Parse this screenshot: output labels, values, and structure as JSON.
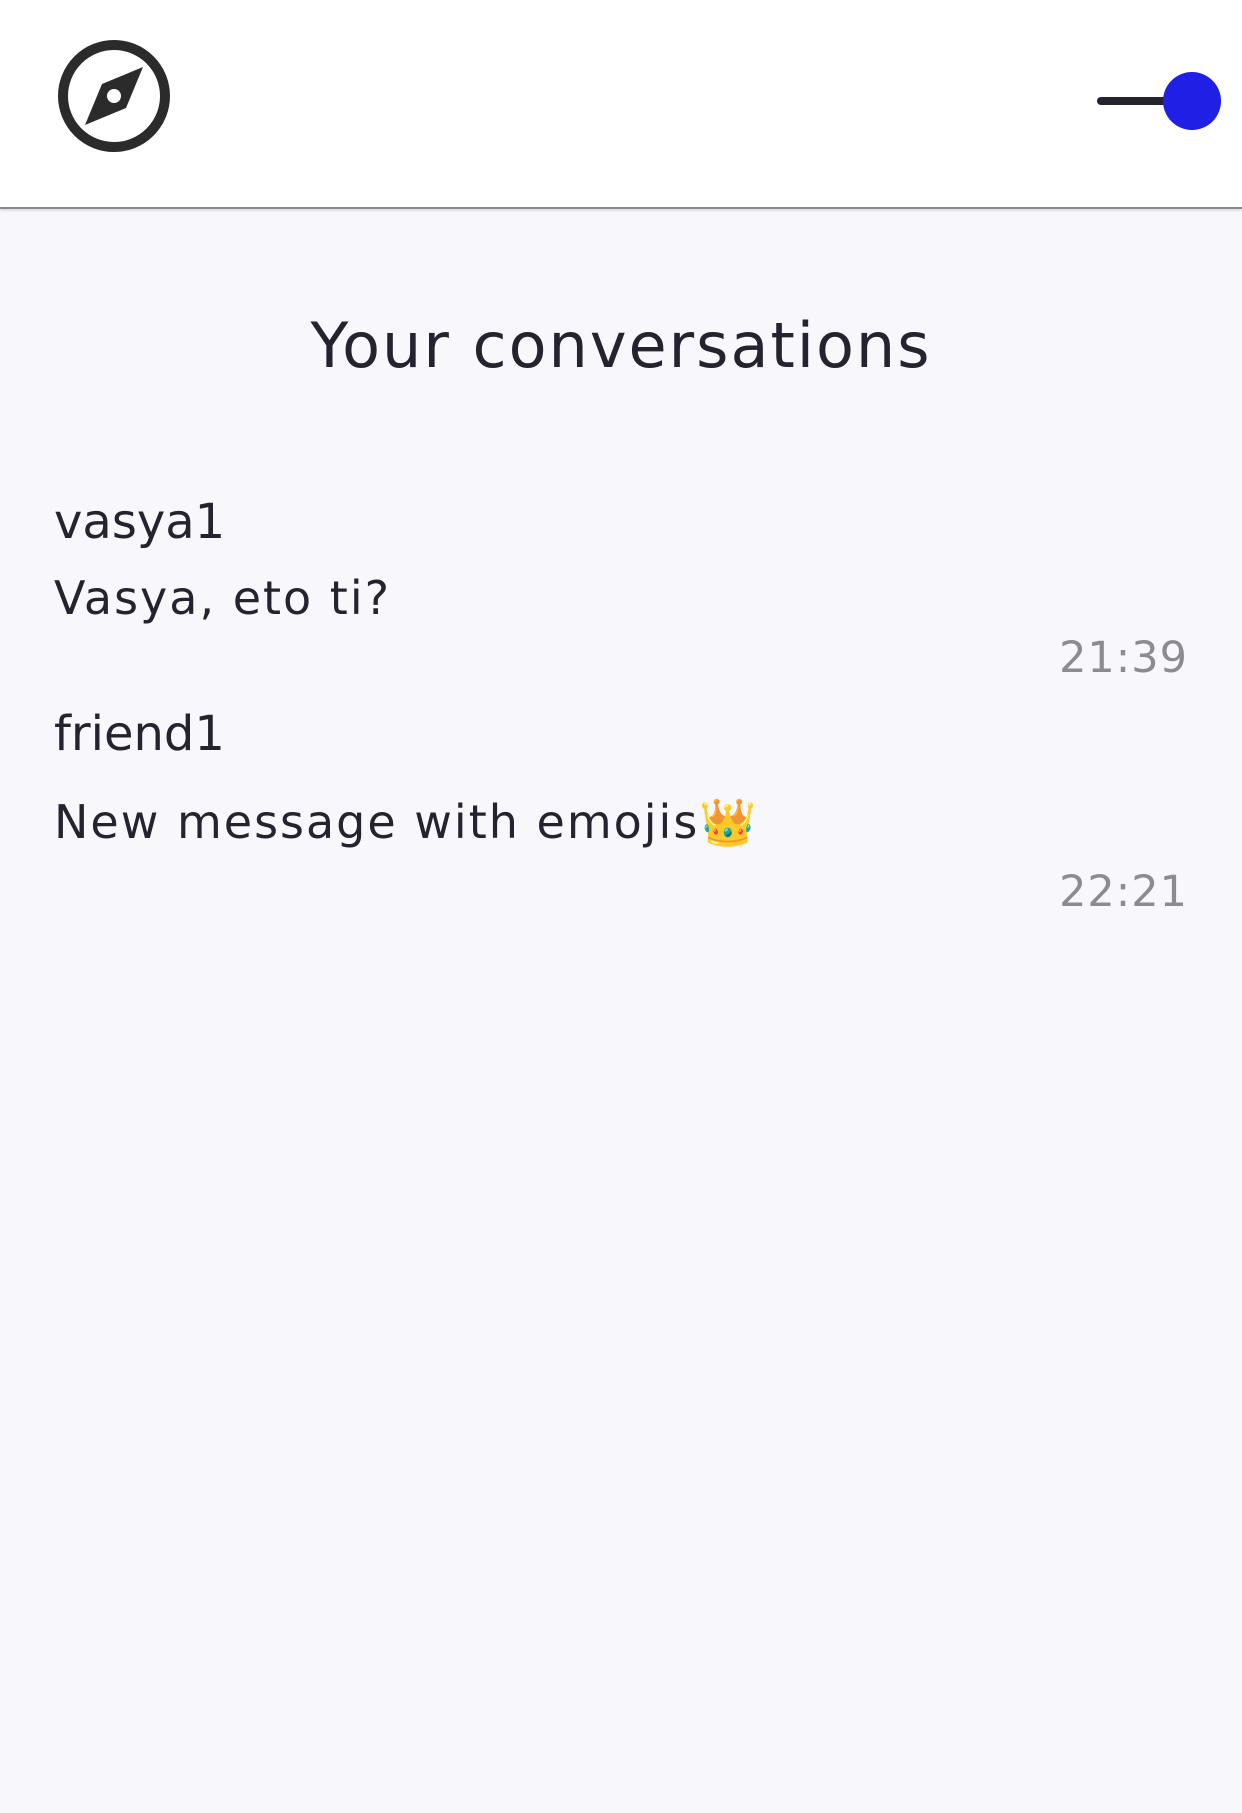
{
  "header": {
    "nav_icon": "compass-icon",
    "toggle": {
      "state": "on",
      "accent_color": "#1f1fe6"
    }
  },
  "page": {
    "title": "Your conversations"
  },
  "conversations": [
    {
      "name": "vasya1",
      "last_message": "Vasya, eto ti?",
      "time": "21:39"
    },
    {
      "name": "friend1",
      "last_message": "New message with emojis👑",
      "time": "22:21"
    }
  ]
}
